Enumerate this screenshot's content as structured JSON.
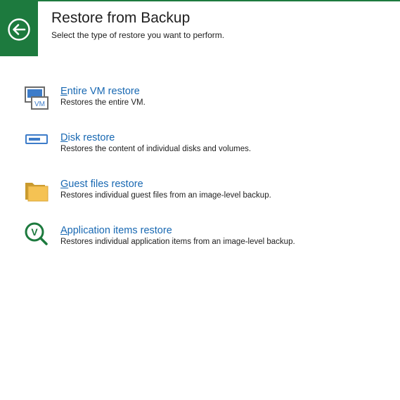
{
  "header": {
    "title": "Restore from Backup",
    "subtitle": "Select the type of restore you want to perform.",
    "accent_color": "#1d7a3e",
    "back_icon": "arrow-left-circle-icon"
  },
  "options": [
    {
      "label_accel": "E",
      "label_rest": "ntire VM restore",
      "description": "Restores the entire VM.",
      "icon": "vm-icon",
      "icon_text": "VM"
    },
    {
      "label_accel": "D",
      "label_rest": "isk restore",
      "description": "Restores the content of individual disks and volumes.",
      "icon": "disk-icon"
    },
    {
      "label_accel": "G",
      "label_rest": "uest files restore",
      "description": "Restores individual guest files from an image-level backup.",
      "icon": "folder-icon"
    },
    {
      "label_accel": "A",
      "label_rest": "pplication items restore",
      "description": "Restores individual application items from an image-level backup.",
      "icon": "application-search-icon",
      "icon_text": "V"
    }
  ],
  "colors": {
    "link": "#1868b2",
    "icon_blue": "#3d7cc9",
    "folder": "#f5c253",
    "app_icon_green": "#1d7a3e"
  }
}
